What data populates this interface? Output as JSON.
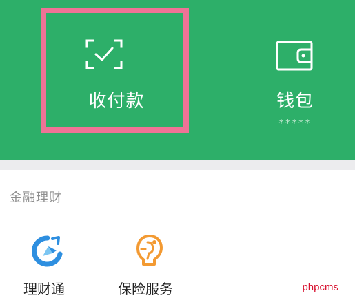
{
  "top_panel": {
    "pay_tile": {
      "label": "收付款",
      "icon": "scan-check-icon"
    },
    "wallet_tile": {
      "label": "钱包",
      "balance_mask": "*****",
      "icon": "wallet-icon"
    }
  },
  "finance_section": {
    "title": "金融理财",
    "items": [
      {
        "label": "理财通",
        "icon": "licaitong-icon"
      },
      {
        "label": "保险服务",
        "icon": "insurance-icon"
      }
    ]
  },
  "watermark": "phpcms",
  "colors": {
    "panel_green": "#2daf69",
    "highlight_pink": "#ef7396",
    "licai_blue": "#2e8fe0",
    "insurance_orange": "#f39a32"
  }
}
